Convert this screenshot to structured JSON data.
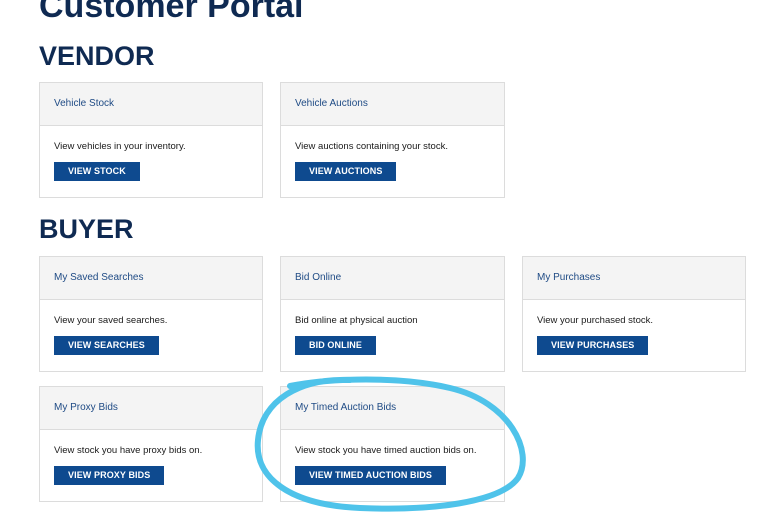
{
  "page": {
    "title": "Customer Portal"
  },
  "vendor": {
    "heading": "VENDOR",
    "cards": [
      {
        "header": "Vehicle Stock",
        "text": "View vehicles in your inventory.",
        "button": "VIEW STOCK"
      },
      {
        "header": "Vehicle Auctions",
        "text": "View auctions containing your stock.",
        "button": "VIEW AUCTIONS"
      }
    ]
  },
  "buyer": {
    "heading": "BUYER",
    "cards": [
      {
        "header": "My Saved Searches",
        "text": "View your saved searches.",
        "button": "VIEW SEARCHES"
      },
      {
        "header": "Bid Online",
        "text": "Bid online at physical auction",
        "button": "BID ONLINE"
      },
      {
        "header": "My Purchases",
        "text": "View your purchased stock.",
        "button": "VIEW PURCHASES"
      },
      {
        "header": "My Proxy Bids",
        "text": "View stock you have proxy bids on.",
        "button": "VIEW PROXY BIDS"
      },
      {
        "header": "My Timed Auction Bids",
        "text": "View stock you have timed auction bids on.",
        "button": "VIEW TIMED AUCTION BIDS"
      }
    ]
  },
  "colors": {
    "heading": "#0f2a52",
    "button": "#0e4a8f",
    "card_header_bg": "#f4f4f4",
    "card_header_text": "#1f4b85",
    "annotation": "#4fc3ea"
  }
}
